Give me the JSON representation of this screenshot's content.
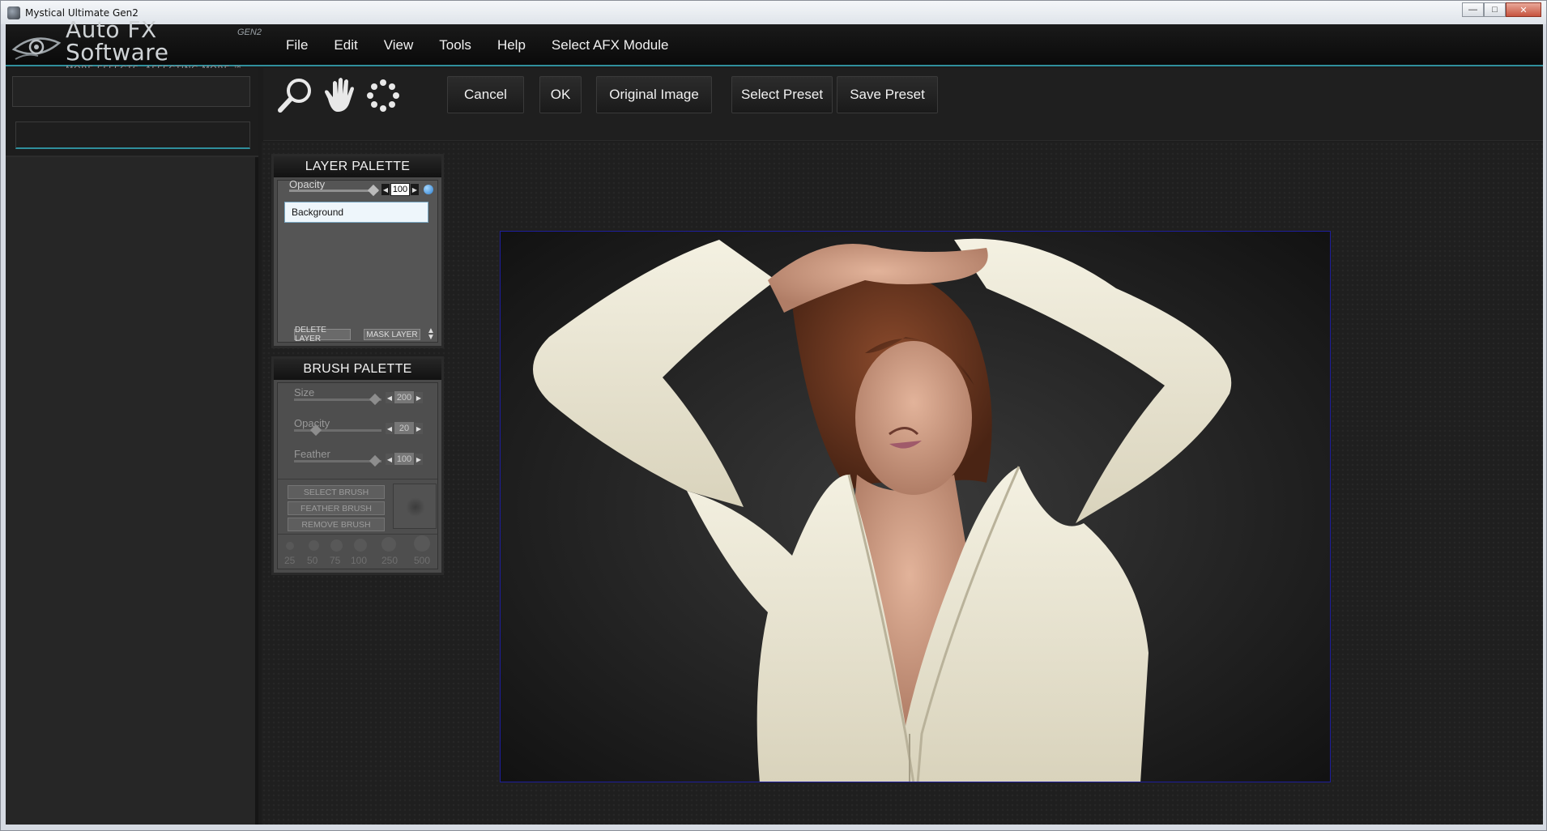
{
  "window": {
    "title": "Mystical Ultimate Gen2",
    "controls": [
      "minimize",
      "maximize",
      "close"
    ]
  },
  "logo": {
    "name": "Auto FX Software",
    "tagline": "MORE EFFECTS. AFFECTING MORE.™",
    "gen": "GEN2"
  },
  "menu": {
    "items": [
      "File",
      "Edit",
      "View",
      "Tools",
      "Help",
      "Select AFX Module"
    ]
  },
  "toolbar": {
    "tools": [
      "zoom-icon",
      "hand-icon",
      "selection-icon"
    ],
    "cancel": "Cancel",
    "ok": "OK",
    "original_image": "Original Image",
    "select_preset": "Select Preset",
    "save_preset": "Save Preset"
  },
  "layer_palette": {
    "title": "LAYER PALETTE",
    "opacity_label": "Opacity",
    "opacity_value": "100",
    "layers": [
      "Background"
    ],
    "delete_layer": "DELETE LAYER",
    "mask_layer": "MASK LAYER"
  },
  "brush_palette": {
    "title": "BRUSH PALETTE",
    "size_label": "Size",
    "size_value": "200",
    "opacity_label": "Opacity",
    "opacity_value": "20",
    "feather_label": "Feather",
    "feather_value": "100",
    "select_brush": "SELECT BRUSH",
    "feather_brush": "FEATHER BRUSH",
    "remove_brush": "REMOVE BRUSH",
    "sizes": [
      "25",
      "50",
      "75",
      "100",
      "250",
      "500"
    ]
  },
  "colors": {
    "accent": "#2f8f9c",
    "frame": "#1e1e9c",
    "background": "#1c1c1c"
  }
}
